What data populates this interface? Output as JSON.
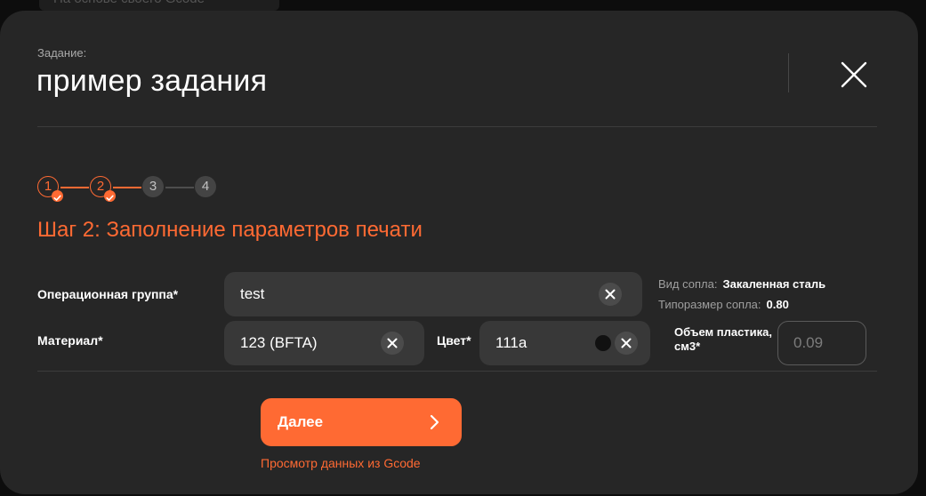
{
  "background": {
    "top_strip_text": "На основе своего Gcode"
  },
  "modal": {
    "task_label": "Задание:",
    "task_title": "пример задания"
  },
  "stepper": {
    "steps": [
      {
        "number": "1",
        "state": "done"
      },
      {
        "number": "2",
        "state": "done"
      },
      {
        "number": "3",
        "state": "pending"
      },
      {
        "number": "4",
        "state": "pending"
      }
    ],
    "current_step_title": "Шаг 2: Заполнение параметров печати"
  },
  "form": {
    "operational_group": {
      "label": "Операционная группа*",
      "value": "test"
    },
    "material": {
      "label": "Материал*",
      "value": "123 (BFTA)"
    },
    "color": {
      "label": "Цвет*",
      "value": "111a",
      "swatch": "#111111"
    },
    "nozzle_type": {
      "label": "Вид сопла:",
      "value": "Закаленная сталь"
    },
    "nozzle_size": {
      "label": "Типоразмер сопла:",
      "value": "0.80"
    },
    "plastic_volume": {
      "label": "Объем пластика, см3*",
      "placeholder": "0.09"
    }
  },
  "actions": {
    "next_label": "Далее",
    "gcode_link": "Просмотр данных из Gcode"
  },
  "colors": {
    "accent": "#ff6a33",
    "modal_bg": "#262626",
    "input_bg": "#383838"
  },
  "icons": {
    "close": "close-icon",
    "clear": "clear-icon",
    "check": "check-icon",
    "chevron": "chevron-right-icon"
  }
}
